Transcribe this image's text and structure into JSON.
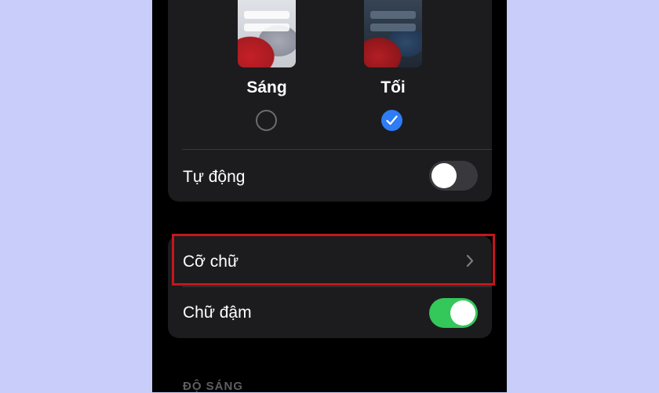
{
  "appearance": {
    "light_label": "Sáng",
    "dark_label": "Tối",
    "selected": "dark",
    "auto_label": "Tự động",
    "auto_on": false
  },
  "text": {
    "text_size_label": "Cỡ chữ",
    "bold_text_label": "Chữ đậm",
    "bold_text_on": true
  },
  "brightness": {
    "section_header": "ĐỘ SÁNG"
  },
  "colors": {
    "background": "#c9cdfa",
    "accent_blue": "#2e7cf6",
    "toggle_green": "#34c759",
    "highlight_red": "#c4161c"
  },
  "icons": [
    "checkmark-icon",
    "chevron-right-icon"
  ]
}
